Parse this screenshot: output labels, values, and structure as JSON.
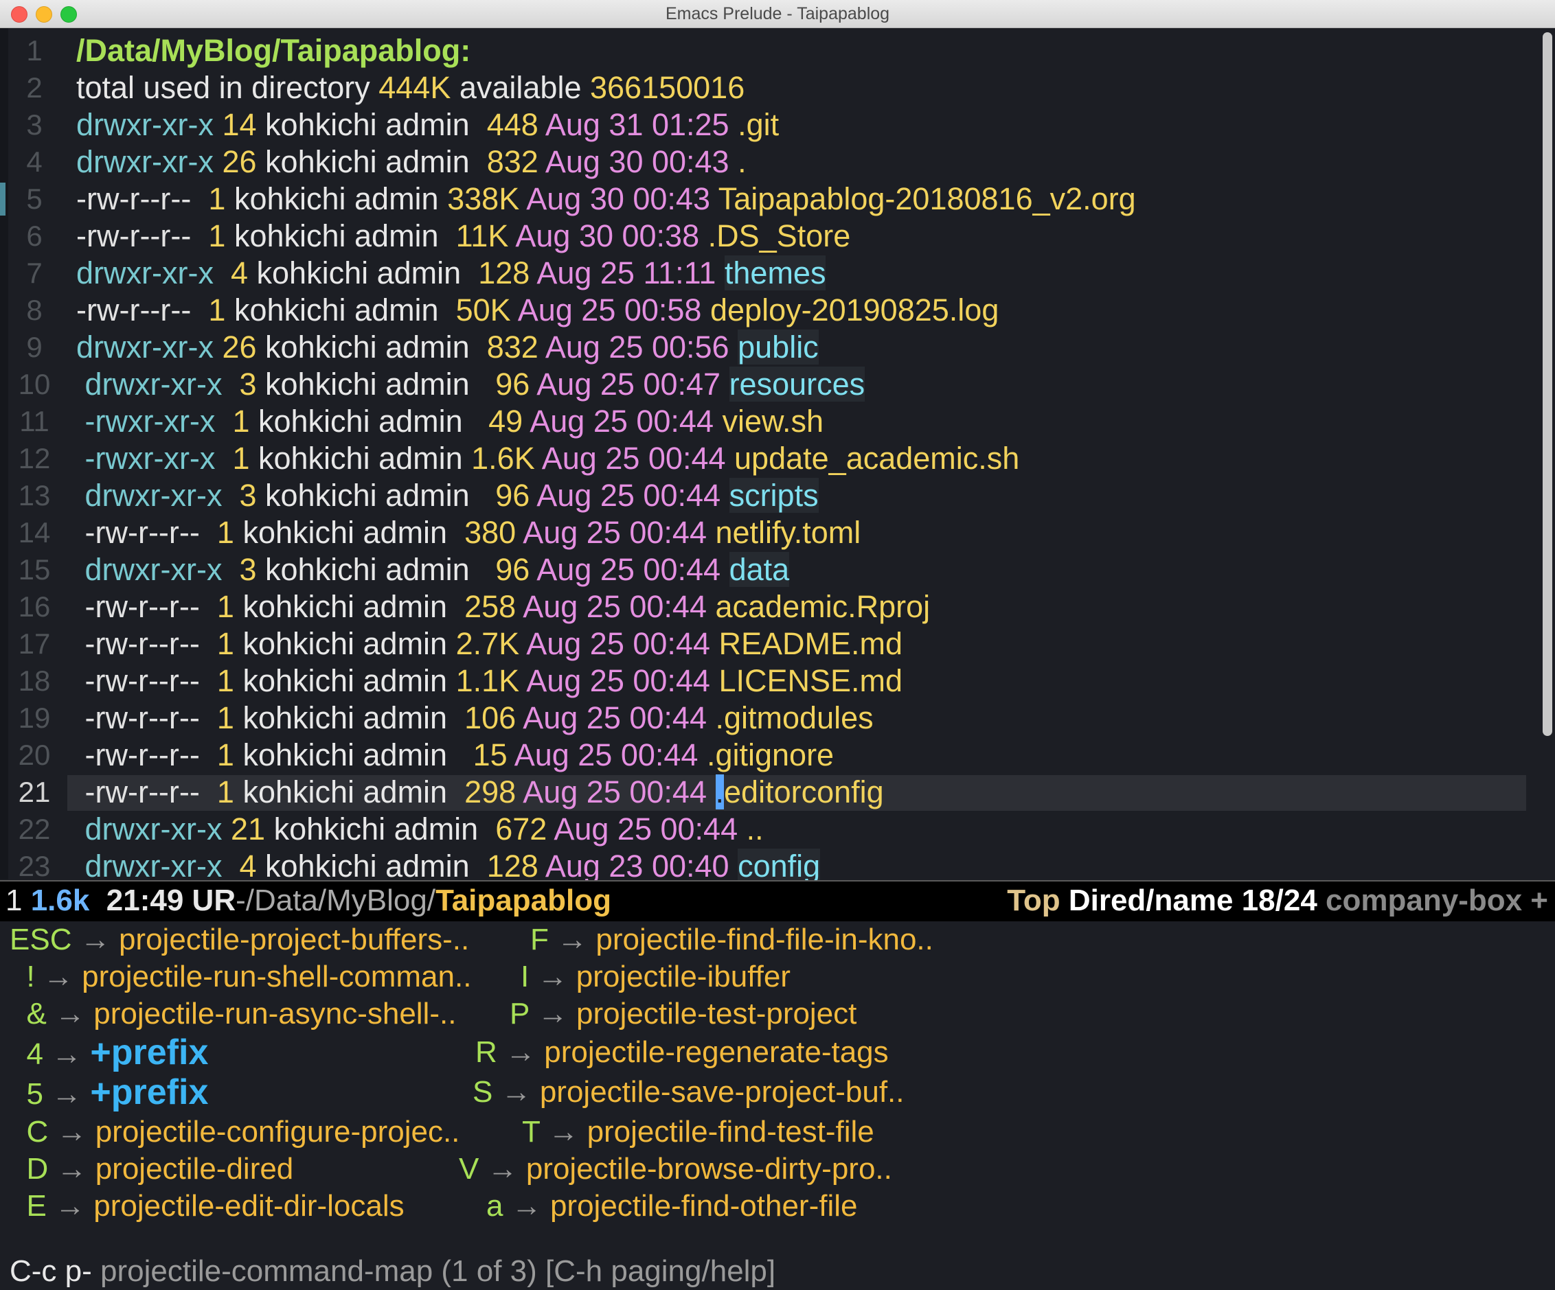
{
  "window": {
    "title": "Emacs Prelude - Taipapablog"
  },
  "dired": {
    "header": "/Data/MyBlog/Taipapablog:",
    "summary": {
      "a": "total used in directory ",
      "used": "444K",
      "b": " available ",
      "available": "366150016"
    },
    "rows": [
      {
        "perm": "drwxr-xr-x",
        "links": "14",
        "owner": "kohkichi admin ",
        "size": "448",
        "date": "Aug 31 01:25",
        "name": ".git",
        "kind": "file"
      },
      {
        "perm": "drwxr-xr-x",
        "links": "26",
        "owner": "kohkichi admin ",
        "size": "832",
        "date": "Aug 30 00:43",
        "name": ".",
        "kind": "file"
      },
      {
        "perm": "-rw-r--r--",
        "links": " 1",
        "owner": "kohkichi admin",
        "size": "338K",
        "date": "Aug 30 00:43",
        "name": "Taipapablog-20180816_v2.org",
        "kind": "file"
      },
      {
        "perm": "-rw-r--r--",
        "links": " 1",
        "owner": "kohkichi admin ",
        "size": "11K",
        "date": "Aug 30 00:38",
        "name": ".DS_Store",
        "kind": "file"
      },
      {
        "perm": "drwxr-xr-x",
        "links": " 4",
        "owner": "kohkichi admin ",
        "size": "128",
        "date": "Aug 25 11:11",
        "name": "themes",
        "kind": "dir"
      },
      {
        "perm": "-rw-r--r--",
        "links": " 1",
        "owner": "kohkichi admin ",
        "size": "50K",
        "date": "Aug 25 00:58",
        "name": "deploy-20190825.log",
        "kind": "file"
      },
      {
        "perm": "drwxr-xr-x",
        "links": "26",
        "owner": "kohkichi admin ",
        "size": "832",
        "date": "Aug 25 00:56",
        "name": "public",
        "kind": "dir"
      },
      {
        "perm": " drwxr-xr-x",
        "links": " 3",
        "owner": "kohkichi admin  ",
        "size": "96",
        "date": "Aug 25 00:47",
        "name": "resources",
        "kind": "dir"
      },
      {
        "perm": " -rwxr-xr-x",
        "links": " 1",
        "owner": "kohkichi admin  ",
        "size": "49",
        "date": "Aug 25 00:44",
        "name": "view.sh",
        "kind": "file"
      },
      {
        "perm": " -rwxr-xr-x",
        "links": " 1",
        "owner": "kohkichi admin",
        "size": "1.6K",
        "date": "Aug 25 00:44",
        "name": "update_academic.sh",
        "kind": "file"
      },
      {
        "perm": " drwxr-xr-x",
        "links": " 3",
        "owner": "kohkichi admin  ",
        "size": "96",
        "date": "Aug 25 00:44",
        "name": "scripts",
        "kind": "dir"
      },
      {
        "perm": " -rw-r--r--",
        "links": " 1",
        "owner": "kohkichi admin ",
        "size": "380",
        "date": "Aug 25 00:44",
        "name": "netlify.toml",
        "kind": "file"
      },
      {
        "perm": " drwxr-xr-x",
        "links": " 3",
        "owner": "kohkichi admin  ",
        "size": "96",
        "date": "Aug 25 00:44",
        "name": "data",
        "kind": "dir"
      },
      {
        "perm": " -rw-r--r--",
        "links": " 1",
        "owner": "kohkichi admin ",
        "size": "258",
        "date": "Aug 25 00:44",
        "name": "academic.Rproj",
        "kind": "file"
      },
      {
        "perm": " -rw-r--r--",
        "links": " 1",
        "owner": "kohkichi admin",
        "size": "2.7K",
        "date": "Aug 25 00:44",
        "name": "README.md",
        "kind": "file"
      },
      {
        "perm": " -rw-r--r--",
        "links": " 1",
        "owner": "kohkichi admin",
        "size": "1.1K",
        "date": "Aug 25 00:44",
        "name": "LICENSE.md",
        "kind": "file"
      },
      {
        "perm": " -rw-r--r--",
        "links": " 1",
        "owner": "kohkichi admin ",
        "size": "106",
        "date": "Aug 25 00:44",
        "name": ".gitmodules",
        "kind": "file"
      },
      {
        "perm": " -rw-r--r--",
        "links": " 1",
        "owner": "kohkichi admin  ",
        "size": "15",
        "date": "Aug 25 00:44",
        "name": ".gitignore",
        "kind": "file"
      },
      {
        "perm": " -rw-r--r--",
        "links": " 1",
        "owner": "kohkichi admin ",
        "size": "298",
        "date": "Aug 25 00:44",
        "name": "editorconfig",
        "kind": "file",
        "cursor": "."
      },
      {
        "perm": " drwxr-xr-x",
        "links": "21",
        "owner": "kohkichi admin ",
        "size": "672",
        "date": "Aug 25 00:44",
        "name": "..",
        "kind": "file"
      },
      {
        "perm": " drwxr-xr-x",
        "links": " 4",
        "owner": "kohkichi admin ",
        "size": "128",
        "date": "Aug 23 00:40",
        "name": "config",
        "kind": "dir"
      }
    ],
    "current_line": 21
  },
  "modeline": {
    "num": "1 ",
    "size": "1.6k",
    "time": "  21:49",
    "ur": " UR",
    "path": "-/Data/MyBlog/",
    "bufname": "Taipapablog",
    "position": "Top ",
    "mode": "Dired/name 18/24 ",
    "minor": "company-box +"
  },
  "whichkey": {
    "rows": [
      {
        "k1": "ESC",
        "c1": "projectile-project-buffers-..",
        "k2": "F",
        "c2": "projectile-find-file-in-kno.."
      },
      {
        "k1": "  !",
        "c1": "projectile-run-shell-comman..",
        "k2": "I",
        "c2": "projectile-ibuffer"
      },
      {
        "k1": "  &",
        "c1": "projectile-run-async-shell-..",
        "k2": "P",
        "c2": "projectile-test-project"
      },
      {
        "k1": "  4",
        "c1": "+prefix",
        "k2": "R",
        "c2": "projectile-regenerate-tags",
        "p": true
      },
      {
        "k1": "  5",
        "c1": "+prefix",
        "k2": "S",
        "c2": "projectile-save-project-buf..",
        "p": true
      },
      {
        "k1": "  C",
        "c1": "projectile-configure-projec..",
        "k2": "T",
        "c2": "projectile-find-test-file"
      },
      {
        "k1": "  D",
        "c1": "projectile-dired",
        "k2": "V",
        "c2": "projectile-browse-dirty-pro.."
      },
      {
        "k1": "  E",
        "c1": "projectile-edit-dir-locals",
        "k2": "a",
        "c2": "projectile-find-other-file"
      }
    ],
    "arrow": "→",
    "echo_key": "C-c p-",
    "echo_text": " projectile-command-map (1 of 3) [C-h paging/help]"
  },
  "colors": {
    "background": "#1c1e24",
    "dir_perm": "#79c9d0",
    "size_and_files": "#f2d35c",
    "dates": "#e48fe0",
    "dirs": "#7fe0f0",
    "header": "#a8e057",
    "prefix": "#3cb5f5",
    "command": "#f2b93d"
  }
}
